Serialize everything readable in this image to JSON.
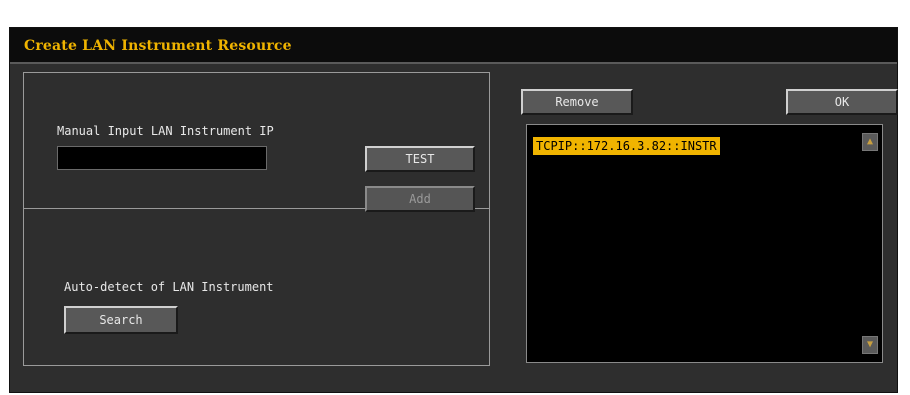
{
  "dialog": {
    "title": "Create LAN Instrument Resource"
  },
  "manual": {
    "label": "Manual Input LAN Instrument IP",
    "ip_value": "",
    "test_label": "TEST",
    "add_label": "Add"
  },
  "auto": {
    "label": "Auto-detect of LAN Instrument",
    "search_label": "Search"
  },
  "actions": {
    "remove_label": "Remove",
    "ok_label": "OK"
  },
  "resources": {
    "items": [
      "TCPIP::172.16.3.82::INSTR"
    ],
    "selected_index": 0,
    "scroll_up_icon": "▲",
    "scroll_down_icon": "▼"
  },
  "colors": {
    "accent": "#f0b400",
    "window_bg": "#2e2e2e",
    "list_bg": "#000000",
    "text": "#e8e8e8"
  }
}
